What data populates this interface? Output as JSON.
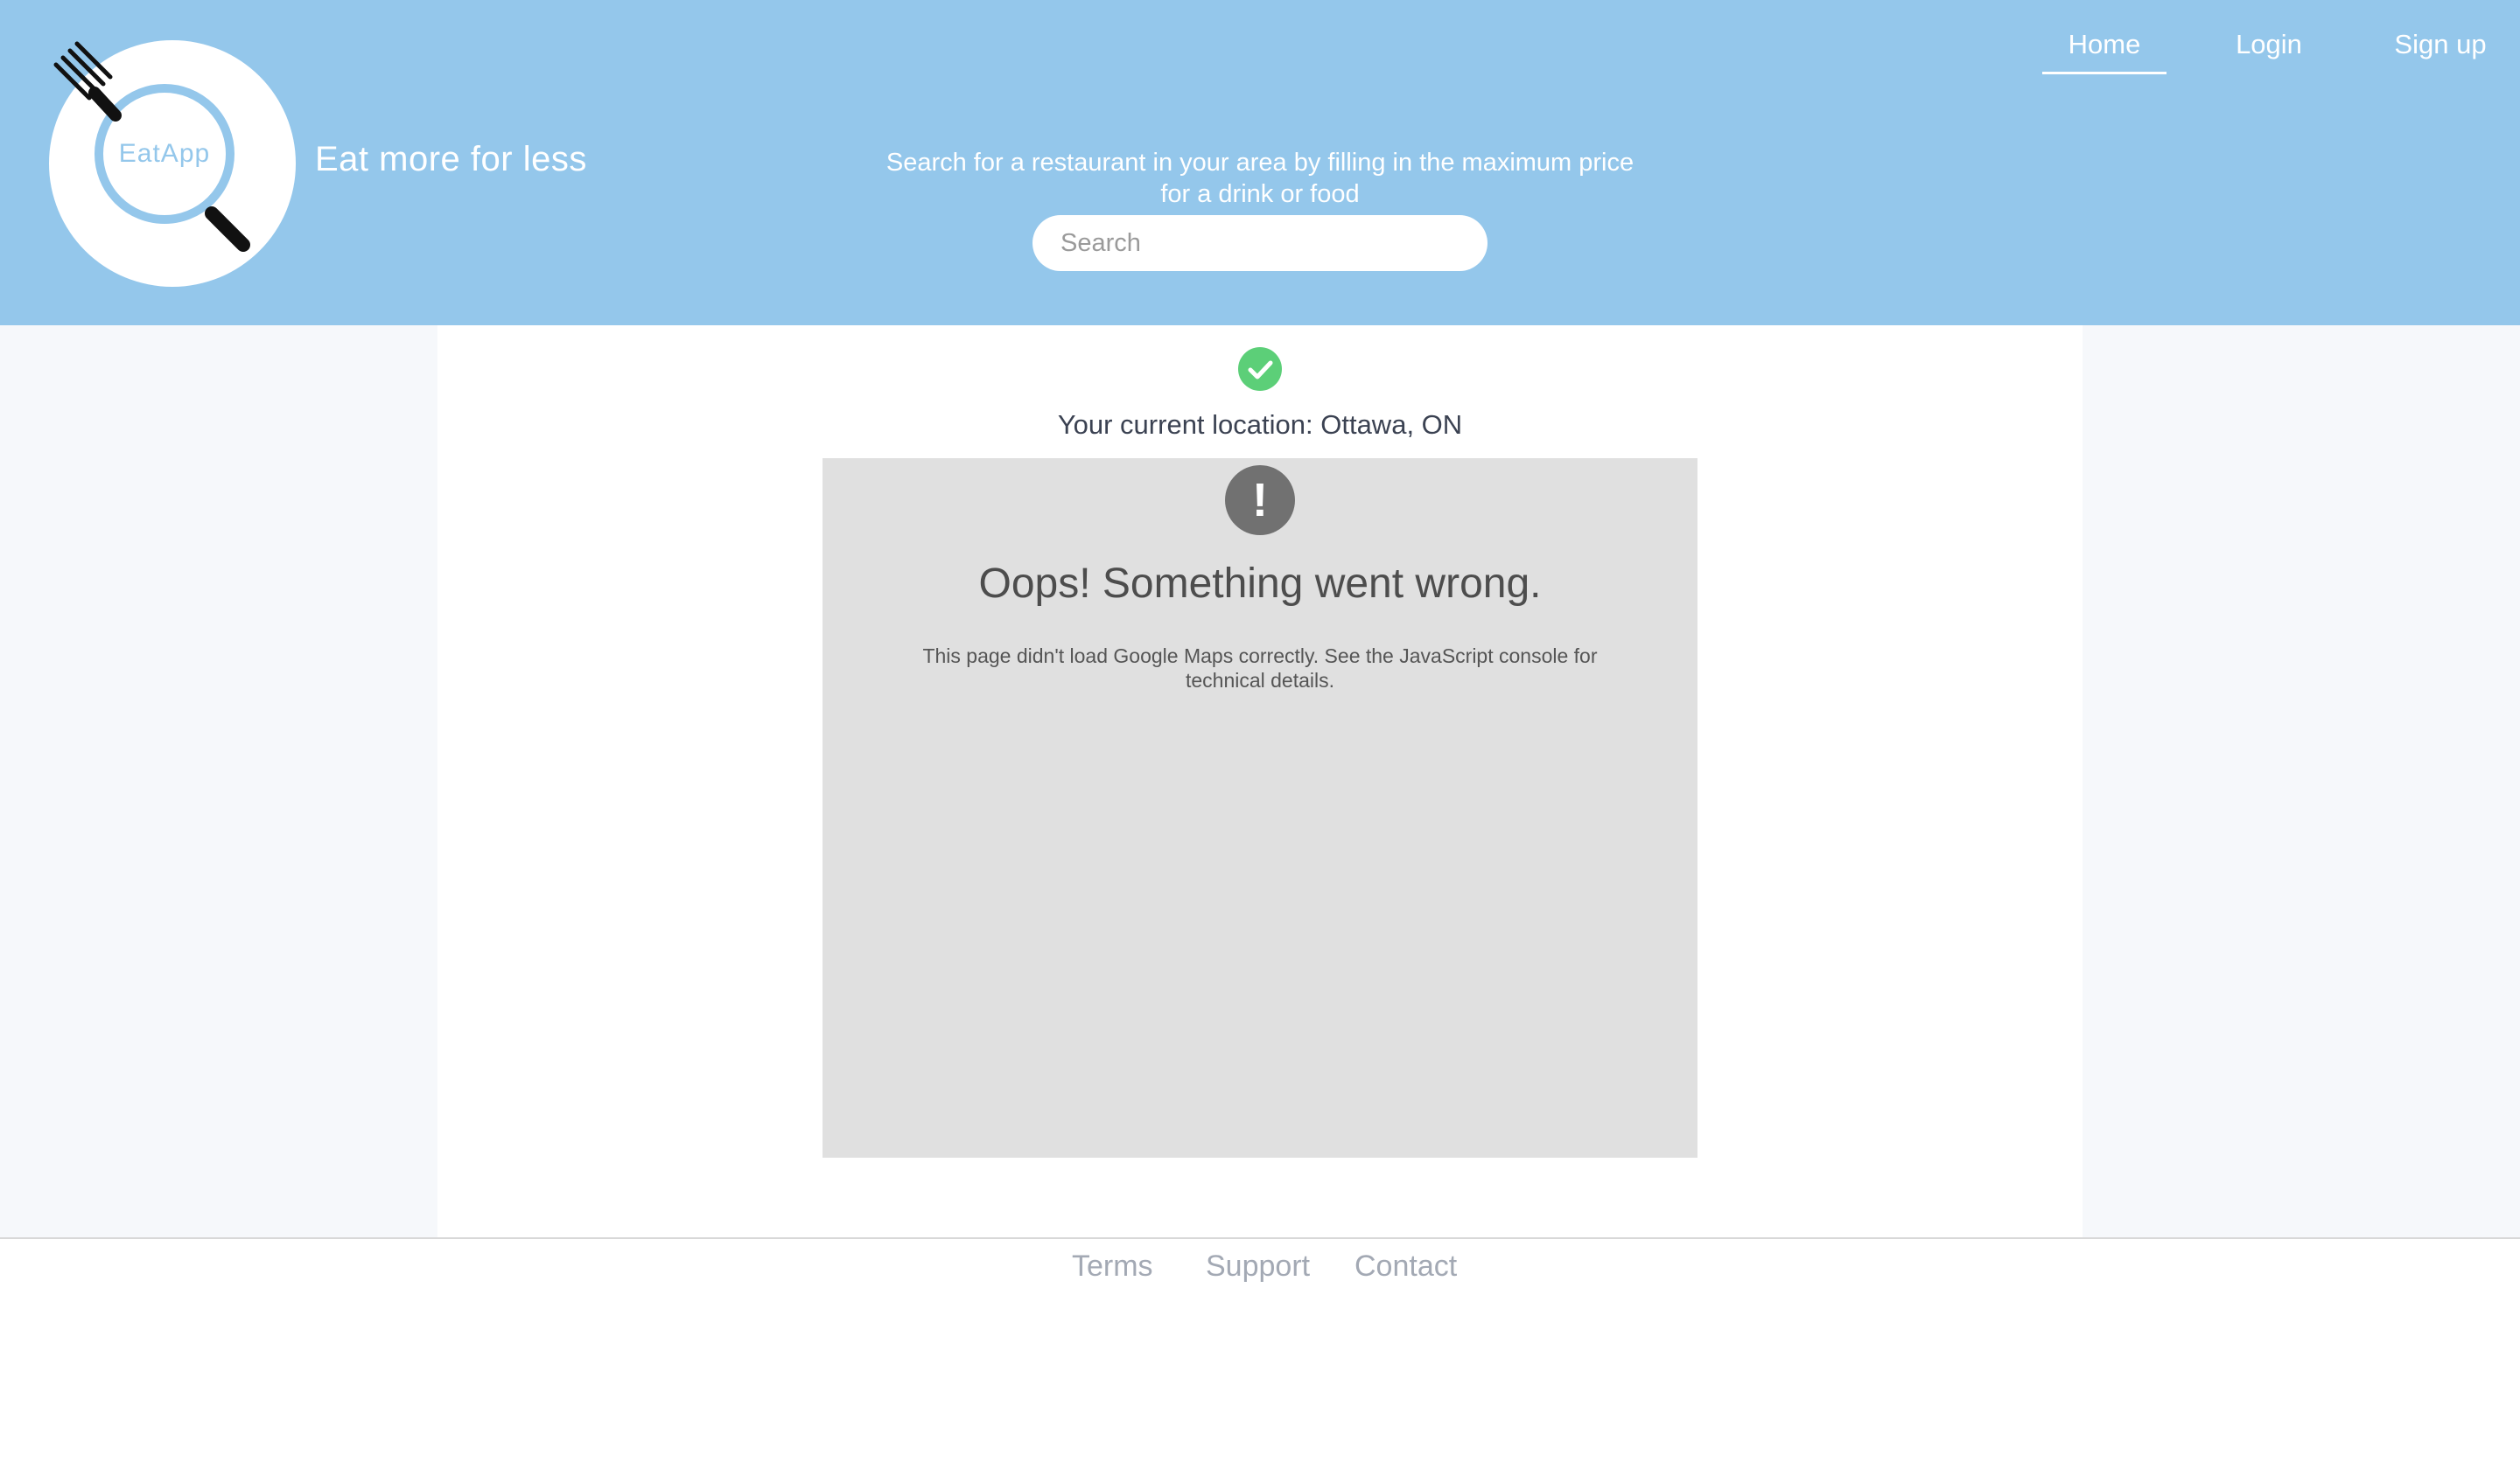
{
  "header": {
    "logo_text": "EatApp",
    "tagline": "Eat more for less",
    "search_hint": "Search for a restaurant in your area by filling in the maximum price for a drink or food",
    "search_placeholder": "Search"
  },
  "nav": {
    "home": "Home",
    "login": "Login",
    "signup": "Sign up"
  },
  "main": {
    "location_text": "Your current location: Ottawa, ON",
    "map_error": {
      "icon_glyph": "!",
      "title": "Oops! Something went wrong.",
      "description": "This page didn't load Google Maps correctly. See the JavaScript console for technical details."
    }
  },
  "footer": {
    "terms": "Terms",
    "support": "Support",
    "contact": "Contact"
  },
  "colors": {
    "header_bg": "#94c7eb",
    "success": "#5ccf78",
    "map_bg": "#e0e0e0"
  }
}
